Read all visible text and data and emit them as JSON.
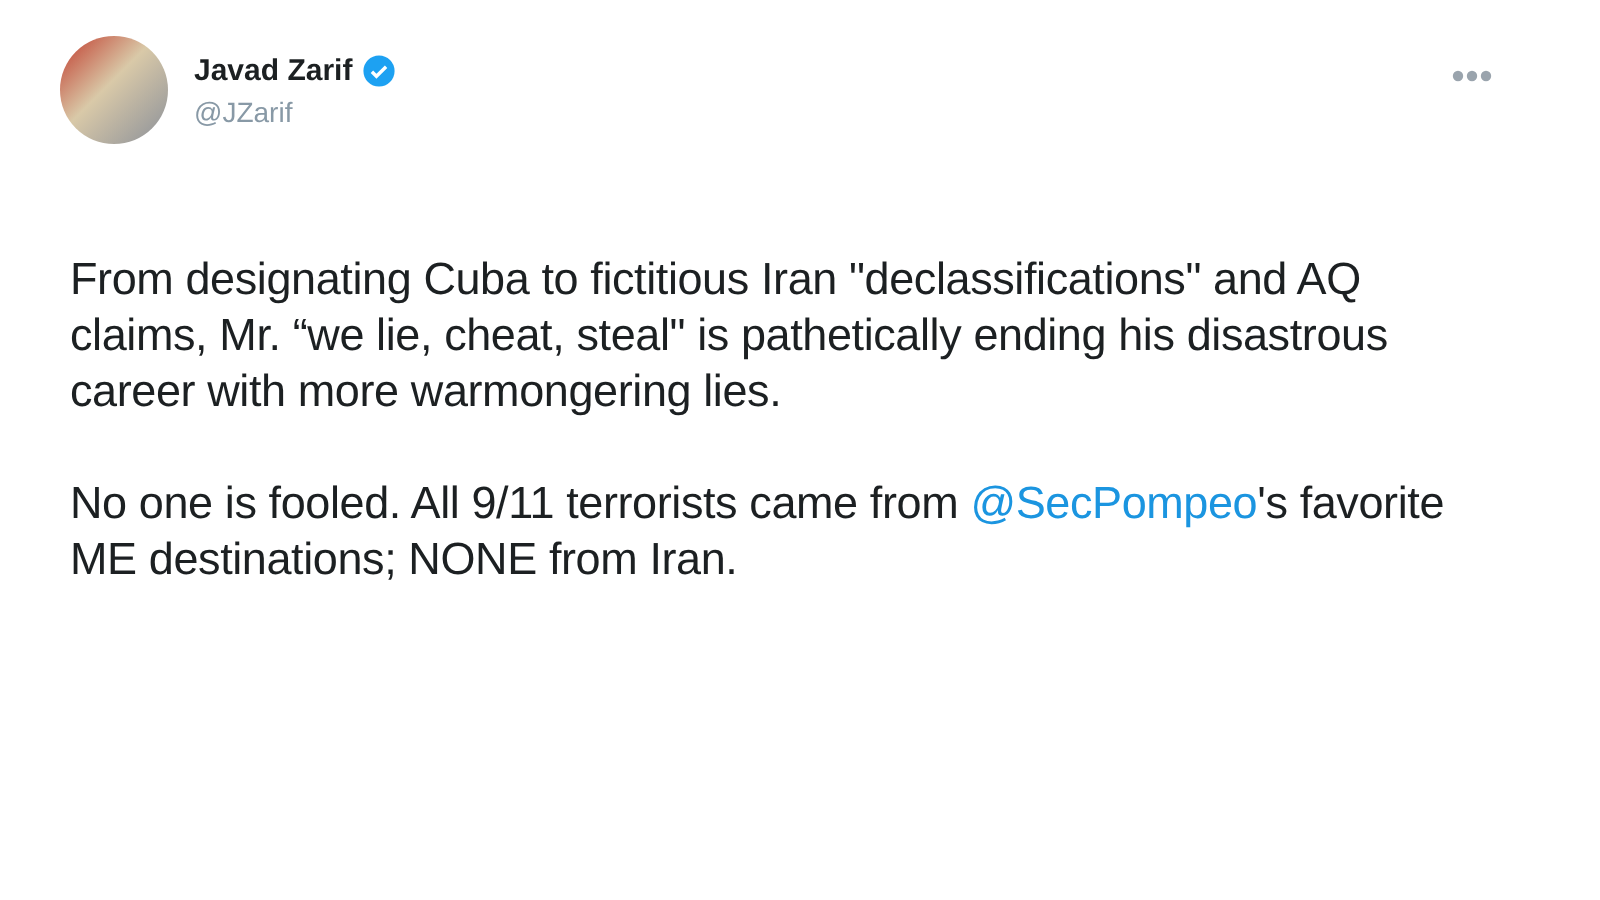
{
  "tweet": {
    "author": {
      "name": "Javad Zarif",
      "handle": "@JZarif",
      "verified": true
    },
    "paragraphs": [
      {
        "segments": [
          {
            "kind": "text",
            "text": "From designating Cuba to fictitious Iran \"declassifications\" and AQ claims, Mr. “we lie, cheat, steal\" is pathetically ending his disastrous career with more warmongering lies."
          }
        ]
      },
      {
        "segments": [
          {
            "kind": "text",
            "text": "No one is fooled. All 9/11 terrorists came from"
          },
          {
            "kind": "mention",
            "text": "@SecPompeo"
          },
          {
            "kind": "text",
            "text": "'s favorite ME destinations; NONE from Iran."
          }
        ]
      }
    ]
  }
}
